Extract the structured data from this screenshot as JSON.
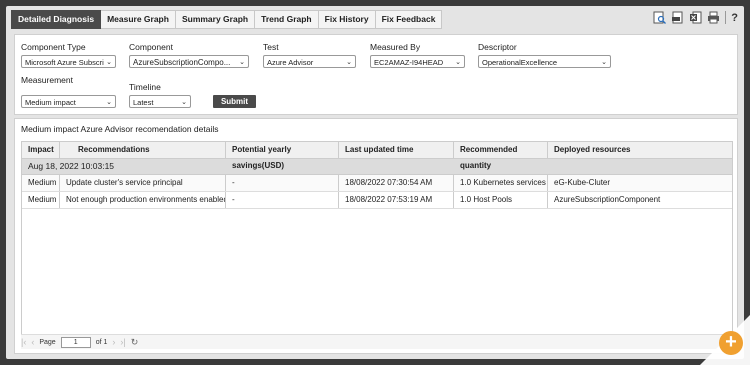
{
  "tabs": [
    "Detailed Diagnosis",
    "Measure Graph",
    "Summary Graph",
    "Trend Graph",
    "Fix History",
    "Fix Feedback"
  ],
  "toolbar": {
    "icons": [
      "search-report-icon",
      "pdf-icon",
      "excel-icon",
      "print-icon"
    ],
    "help": "?"
  },
  "filters": {
    "component_type_label": "Component Type",
    "component_type_value": "Microsoft Azure Subscri",
    "component_label": "Component",
    "component_value": "AzureSubscriptionCompo...",
    "test_label": "Test",
    "test_value": "Azure Advisor",
    "measured_by_label": "Measured By",
    "measured_by_value": "EC2AMAZ-I94HEAD",
    "descriptor_label": "Descriptor",
    "descriptor_value": "OperationalExcellence",
    "measurement_label": "Measurement",
    "measurement_value": "Medium impact",
    "timeline_label": "Timeline",
    "timeline_value": "Latest",
    "submit_label": "Submit"
  },
  "results": {
    "title": "Medium impact Azure Advisor recomendation details",
    "columns": [
      "Impact",
      "Recommendations",
      "Potential yearly savings(USD)",
      "Last updated time",
      "Recommended quantity",
      "Deployed resources"
    ],
    "group_label": "Aug 18, 2022 10:03:15",
    "rows": [
      [
        "Medium",
        "Update cluster's service principal",
        "-",
        "18/08/2022 07:30:54 AM",
        "1.0 Kubernetes services",
        "eG-Kube-Cluter"
      ],
      [
        "Medium",
        "Not enough production environments enabled",
        "-",
        "18/08/2022 07:53:19 AM",
        "1.0 Host Pools",
        "AzureSubscriptionComponent"
      ]
    ]
  },
  "pager": {
    "page_label": "Page",
    "page_value": "1",
    "of_label": "of 1"
  },
  "fab_label": "+",
  "colors": {
    "active_tab": "#4a4a4a",
    "fab": "#f0a030"
  }
}
